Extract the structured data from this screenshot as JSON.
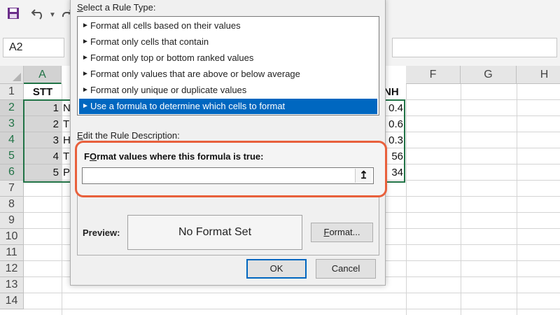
{
  "excel": {
    "name_box": "A2",
    "columns": [
      {
        "label": "A",
        "selected": true
      },
      {
        "label": "F",
        "selected": false
      },
      {
        "label": "G",
        "selected": false
      },
      {
        "label": "H",
        "selected": false
      }
    ],
    "rows": [
      "1",
      "2",
      "3",
      "4",
      "5",
      "6",
      "7",
      "8",
      "9",
      "10",
      "11",
      "12",
      "13",
      "14"
    ],
    "header_cell_a": "STT",
    "stt_values": [
      "1",
      "2",
      "3",
      "4",
      "5"
    ],
    "col_b_fragments": [
      "N",
      "T",
      "H",
      "T",
      "P"
    ],
    "right_header_fragment": "NH",
    "right_values": [
      "0.4",
      "0.6",
      "0.3",
      "56",
      "34"
    ]
  },
  "dialog": {
    "rule_type_label_pre": "",
    "rule_type_label_underlined": "S",
    "rule_type_label_post": "elect a Rule Type:",
    "rule_types": [
      "Format all cells based on their values",
      "Format only cells that contain",
      "Format only top or bottom ranked values",
      "Format only values that are above or below average",
      "Format only unique or duplicate values",
      "Use a formula to determine which cells to format"
    ],
    "rule_arrow": "►",
    "selected_rule_index": 5,
    "edit_description_label_pre": "",
    "edit_description_label_underlined": "E",
    "edit_description_label_post": "dit the Rule Description:",
    "formula_label_underlined": "O",
    "formula_label_post": "rmat values where this formula is true:",
    "formula_label_pre": "F",
    "formula_value": "",
    "collapse_icon": "↥",
    "preview_label": "Preview:",
    "preview_text": "No Format Set",
    "format_button_underlined": "F",
    "format_button_post": "ormat...",
    "ok_label": "OK",
    "cancel_label": "Cancel"
  },
  "colors": {
    "accent_green": "#217346",
    "selection_blue": "#0067c0",
    "highlight_orange": "#e8603c"
  }
}
